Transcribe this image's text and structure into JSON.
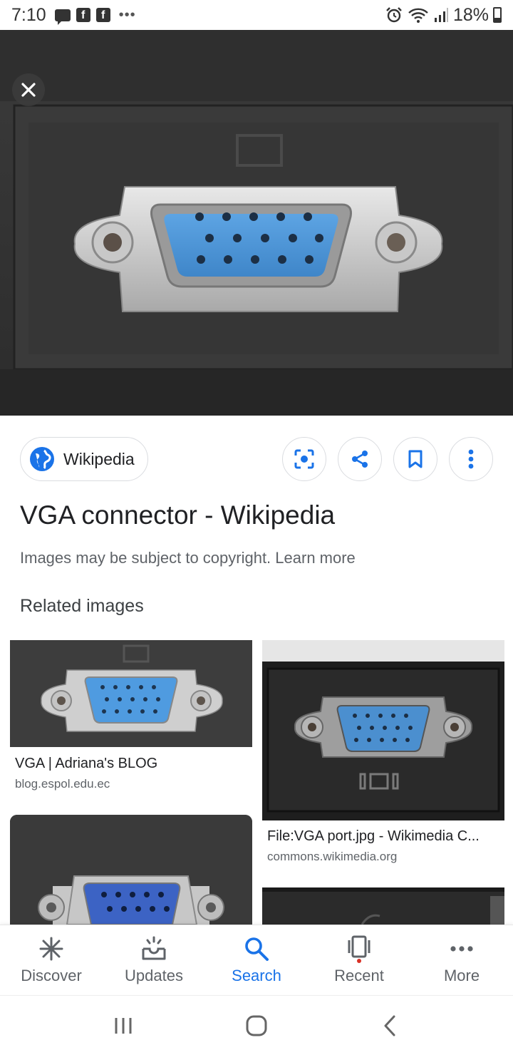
{
  "status_bar": {
    "time": "7:10",
    "battery": "18%",
    "icons": [
      "message-icon",
      "facebook-icon",
      "facebook-icon",
      "more-dots-icon",
      "alarm-icon",
      "wifi-icon",
      "signal-icon",
      "battery-icon"
    ]
  },
  "viewer": {
    "close_icon": "close-icon"
  },
  "source": {
    "name": "Wikipedia",
    "icon": "globe-icon",
    "actions": [
      "lens-icon",
      "share-icon",
      "bookmark-icon",
      "more-vert-icon"
    ]
  },
  "result": {
    "title": "VGA connector - Wikipedia",
    "copyright_note": "Images may be subject to copyright. Learn more"
  },
  "related": {
    "heading": "Related images",
    "items": [
      {
        "title": "VGA | Adriana's BLOG",
        "domain": "blog.espol.edu.ec"
      },
      {
        "title": "File:VGA port.jpg - Wikimedia C...",
        "domain": "commons.wikimedia.org"
      },
      {
        "title": "",
        "domain": ""
      },
      {
        "title": "",
        "domain": ""
      }
    ]
  },
  "bottom_nav": {
    "items": [
      {
        "label": "Discover",
        "icon": "asterisk-icon"
      },
      {
        "label": "Updates",
        "icon": "inbox-icon"
      },
      {
        "label": "Search",
        "icon": "search-icon"
      },
      {
        "label": "Recent",
        "icon": "recent-icon"
      },
      {
        "label": "More",
        "icon": "more-dots-icon"
      }
    ],
    "active": "Search"
  },
  "colors": {
    "accent": "#1a73e8",
    "connector_blue": "#4a90d0",
    "text_primary": "#202124",
    "text_secondary": "#5f6368"
  }
}
